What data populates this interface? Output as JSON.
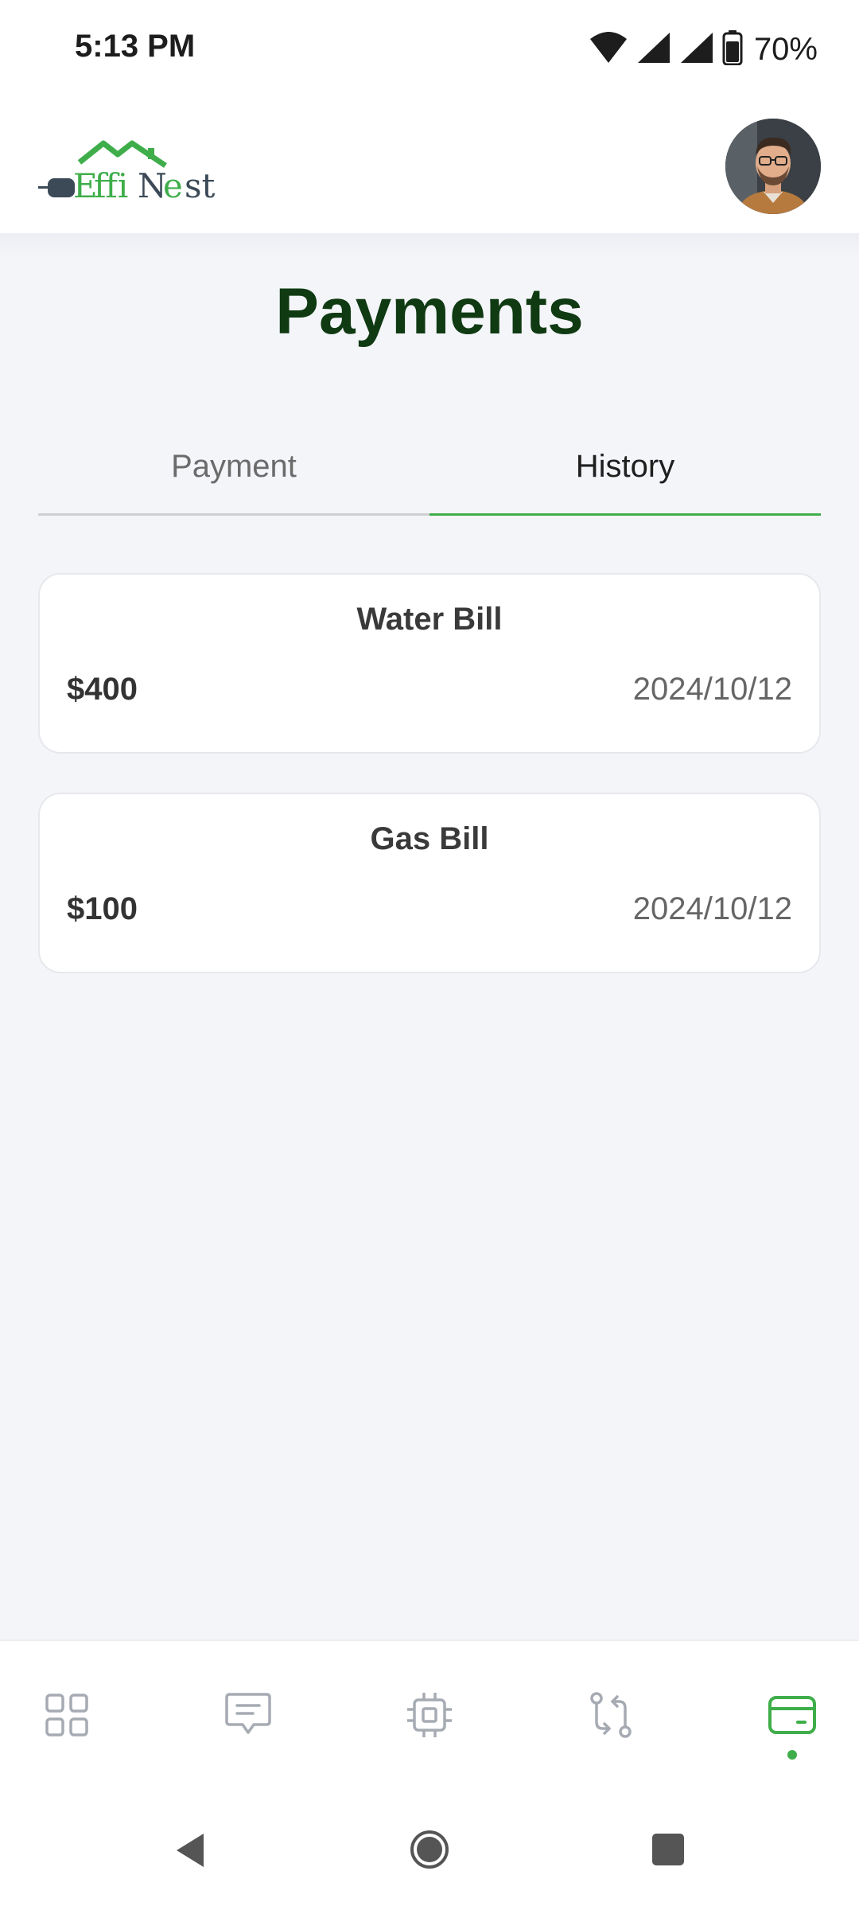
{
  "status_bar": {
    "time": "5:13 PM",
    "battery_percent": "70%",
    "icons": [
      "wifi-icon",
      "signal-icon",
      "signal-icon",
      "battery-icon"
    ]
  },
  "header": {
    "logo_text": "EffiNest",
    "avatar": "user-avatar"
  },
  "page": {
    "title": "Payments"
  },
  "tabs": {
    "items": [
      {
        "label": "Payment",
        "active": false
      },
      {
        "label": "History",
        "active": true
      }
    ]
  },
  "history": {
    "items": [
      {
        "title": "Water Bill",
        "amount": "$400",
        "date": "2024/10/12"
      },
      {
        "title": "Gas Bill",
        "amount": "$100",
        "date": "2024/10/12"
      }
    ]
  },
  "bottom_nav": {
    "items": [
      {
        "icon": "grid-icon",
        "active": false
      },
      {
        "icon": "chat-icon",
        "active": false
      },
      {
        "icon": "chip-icon",
        "active": false
      },
      {
        "icon": "transfer-icon",
        "active": false
      },
      {
        "icon": "card-icon",
        "active": true
      }
    ]
  },
  "colors": {
    "brand_green": "#3fae4a",
    "title_green": "#0f3a12",
    "background": "#f4f5f9"
  }
}
